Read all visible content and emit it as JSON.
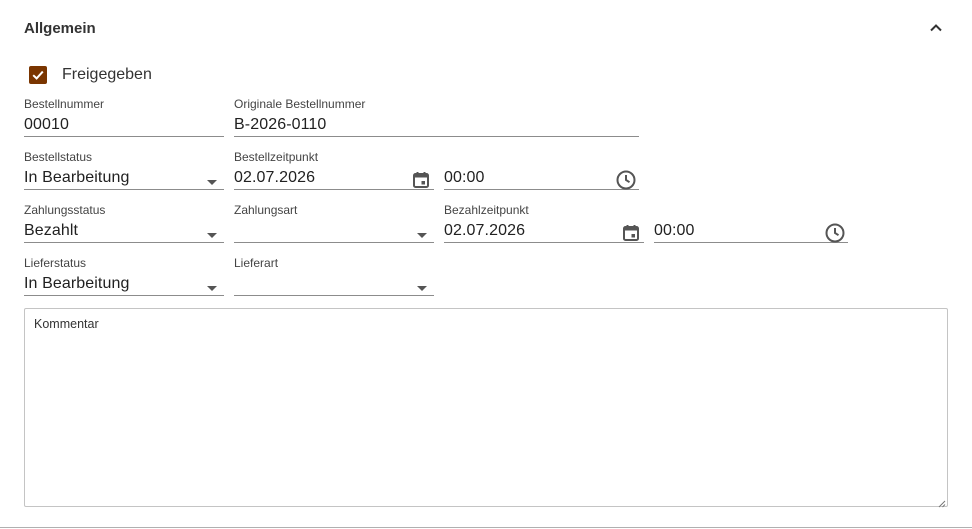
{
  "section": {
    "title": "Allgemein"
  },
  "released": {
    "label": "Freigegeben",
    "checked": true
  },
  "order_number": {
    "label": "Bestellnummer",
    "value": "00010"
  },
  "original_order_number": {
    "label": "Originale Bestellnummer",
    "value": "B-2026-0110"
  },
  "order_status": {
    "label": "Bestellstatus",
    "value": "In Bearbeitung"
  },
  "order_time": {
    "label": "Bestellzeitpunkt",
    "date": "02.07.2026",
    "time": "00:00"
  },
  "payment_status": {
    "label": "Zahlungsstatus",
    "value": "Bezahlt"
  },
  "payment_method": {
    "label": "Zahlungsart",
    "value": ""
  },
  "payment_time": {
    "label": "Bezahlzeitpunkt",
    "date": "02.07.2026",
    "time": "00:00"
  },
  "delivery_status": {
    "label": "Lieferstatus",
    "value": "In Bearbeitung"
  },
  "delivery_method": {
    "label": "Lieferart",
    "value": ""
  },
  "comment": {
    "label": "Kommentar",
    "value": ""
  },
  "colors": {
    "accent": "#7a3500",
    "underline": "#8c8c8c",
    "icon": "#555555"
  },
  "icons": {
    "collapse": "chevron-up-icon",
    "checkbox": "check-icon",
    "date": "calendar-icon",
    "time": "clock-icon",
    "dropdown": "caret-down-icon"
  }
}
